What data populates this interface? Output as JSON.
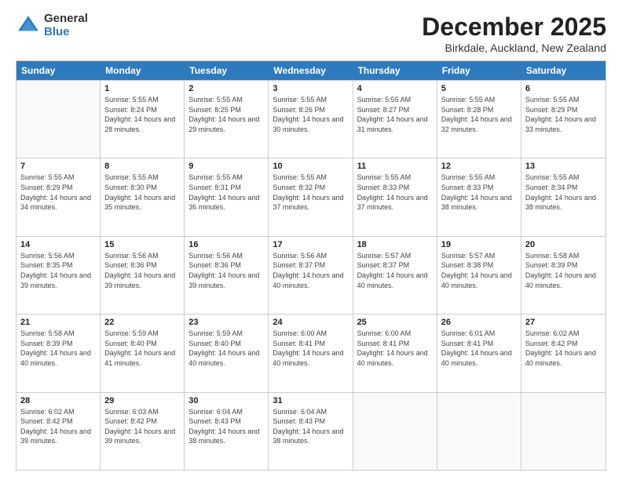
{
  "logo": {
    "general": "General",
    "blue": "Blue"
  },
  "title": "December 2025",
  "subtitle": "Birkdale, Auckland, New Zealand",
  "header_days": [
    "Sunday",
    "Monday",
    "Tuesday",
    "Wednesday",
    "Thursday",
    "Friday",
    "Saturday"
  ],
  "weeks": [
    [
      {
        "day": "",
        "sunrise": "",
        "sunset": "",
        "daylight": ""
      },
      {
        "day": "1",
        "sunrise": "Sunrise: 5:55 AM",
        "sunset": "Sunset: 8:24 PM",
        "daylight": "Daylight: 14 hours and 28 minutes."
      },
      {
        "day": "2",
        "sunrise": "Sunrise: 5:55 AM",
        "sunset": "Sunset: 8:25 PM",
        "daylight": "Daylight: 14 hours and 29 minutes."
      },
      {
        "day": "3",
        "sunrise": "Sunrise: 5:55 AM",
        "sunset": "Sunset: 8:26 PM",
        "daylight": "Daylight: 14 hours and 30 minutes."
      },
      {
        "day": "4",
        "sunrise": "Sunrise: 5:55 AM",
        "sunset": "Sunset: 8:27 PM",
        "daylight": "Daylight: 14 hours and 31 minutes."
      },
      {
        "day": "5",
        "sunrise": "Sunrise: 5:55 AM",
        "sunset": "Sunset: 8:28 PM",
        "daylight": "Daylight: 14 hours and 32 minutes."
      },
      {
        "day": "6",
        "sunrise": "Sunrise: 5:55 AM",
        "sunset": "Sunset: 8:29 PM",
        "daylight": "Daylight: 14 hours and 33 minutes."
      }
    ],
    [
      {
        "day": "7",
        "sunrise": "Sunrise: 5:55 AM",
        "sunset": "Sunset: 8:29 PM",
        "daylight": "Daylight: 14 hours and 34 minutes."
      },
      {
        "day": "8",
        "sunrise": "Sunrise: 5:55 AM",
        "sunset": "Sunset: 8:30 PM",
        "daylight": "Daylight: 14 hours and 35 minutes."
      },
      {
        "day": "9",
        "sunrise": "Sunrise: 5:55 AM",
        "sunset": "Sunset: 8:31 PM",
        "daylight": "Daylight: 14 hours and 36 minutes."
      },
      {
        "day": "10",
        "sunrise": "Sunrise: 5:55 AM",
        "sunset": "Sunset: 8:32 PM",
        "daylight": "Daylight: 14 hours and 37 minutes."
      },
      {
        "day": "11",
        "sunrise": "Sunrise: 5:55 AM",
        "sunset": "Sunset: 8:33 PM",
        "daylight": "Daylight: 14 hours and 37 minutes."
      },
      {
        "day": "12",
        "sunrise": "Sunrise: 5:55 AM",
        "sunset": "Sunset: 8:33 PM",
        "daylight": "Daylight: 14 hours and 38 minutes."
      },
      {
        "day": "13",
        "sunrise": "Sunrise: 5:55 AM",
        "sunset": "Sunset: 8:34 PM",
        "daylight": "Daylight: 14 hours and 38 minutes."
      }
    ],
    [
      {
        "day": "14",
        "sunrise": "Sunrise: 5:56 AM",
        "sunset": "Sunset: 8:35 PM",
        "daylight": "Daylight: 14 hours and 39 minutes."
      },
      {
        "day": "15",
        "sunrise": "Sunrise: 5:56 AM",
        "sunset": "Sunset: 8:36 PM",
        "daylight": "Daylight: 14 hours and 39 minutes."
      },
      {
        "day": "16",
        "sunrise": "Sunrise: 5:56 AM",
        "sunset": "Sunset: 8:36 PM",
        "daylight": "Daylight: 14 hours and 39 minutes."
      },
      {
        "day": "17",
        "sunrise": "Sunrise: 5:56 AM",
        "sunset": "Sunset: 8:37 PM",
        "daylight": "Daylight: 14 hours and 40 minutes."
      },
      {
        "day": "18",
        "sunrise": "Sunrise: 5:57 AM",
        "sunset": "Sunset: 8:37 PM",
        "daylight": "Daylight: 14 hours and 40 minutes."
      },
      {
        "day": "19",
        "sunrise": "Sunrise: 5:57 AM",
        "sunset": "Sunset: 8:38 PM",
        "daylight": "Daylight: 14 hours and 40 minutes."
      },
      {
        "day": "20",
        "sunrise": "Sunrise: 5:58 AM",
        "sunset": "Sunset: 8:39 PM",
        "daylight": "Daylight: 14 hours and 40 minutes."
      }
    ],
    [
      {
        "day": "21",
        "sunrise": "Sunrise: 5:58 AM",
        "sunset": "Sunset: 8:39 PM",
        "daylight": "Daylight: 14 hours and 40 minutes."
      },
      {
        "day": "22",
        "sunrise": "Sunrise: 5:59 AM",
        "sunset": "Sunset: 8:40 PM",
        "daylight": "Daylight: 14 hours and 41 minutes."
      },
      {
        "day": "23",
        "sunrise": "Sunrise: 5:59 AM",
        "sunset": "Sunset: 8:40 PM",
        "daylight": "Daylight: 14 hours and 40 minutes."
      },
      {
        "day": "24",
        "sunrise": "Sunrise: 6:00 AM",
        "sunset": "Sunset: 8:41 PM",
        "daylight": "Daylight: 14 hours and 40 minutes."
      },
      {
        "day": "25",
        "sunrise": "Sunrise: 6:00 AM",
        "sunset": "Sunset: 8:41 PM",
        "daylight": "Daylight: 14 hours and 40 minutes."
      },
      {
        "day": "26",
        "sunrise": "Sunrise: 6:01 AM",
        "sunset": "Sunset: 8:41 PM",
        "daylight": "Daylight: 14 hours and 40 minutes."
      },
      {
        "day": "27",
        "sunrise": "Sunrise: 6:02 AM",
        "sunset": "Sunset: 8:42 PM",
        "daylight": "Daylight: 14 hours and 40 minutes."
      }
    ],
    [
      {
        "day": "28",
        "sunrise": "Sunrise: 6:02 AM",
        "sunset": "Sunset: 8:42 PM",
        "daylight": "Daylight: 14 hours and 39 minutes."
      },
      {
        "day": "29",
        "sunrise": "Sunrise: 6:03 AM",
        "sunset": "Sunset: 8:42 PM",
        "daylight": "Daylight: 14 hours and 39 minutes."
      },
      {
        "day": "30",
        "sunrise": "Sunrise: 6:04 AM",
        "sunset": "Sunset: 8:43 PM",
        "daylight": "Daylight: 14 hours and 38 minutes."
      },
      {
        "day": "31",
        "sunrise": "Sunrise: 6:04 AM",
        "sunset": "Sunset: 8:43 PM",
        "daylight": "Daylight: 14 hours and 38 minutes."
      },
      {
        "day": "",
        "sunrise": "",
        "sunset": "",
        "daylight": ""
      },
      {
        "day": "",
        "sunrise": "",
        "sunset": "",
        "daylight": ""
      },
      {
        "day": "",
        "sunrise": "",
        "sunset": "",
        "daylight": ""
      }
    ]
  ]
}
